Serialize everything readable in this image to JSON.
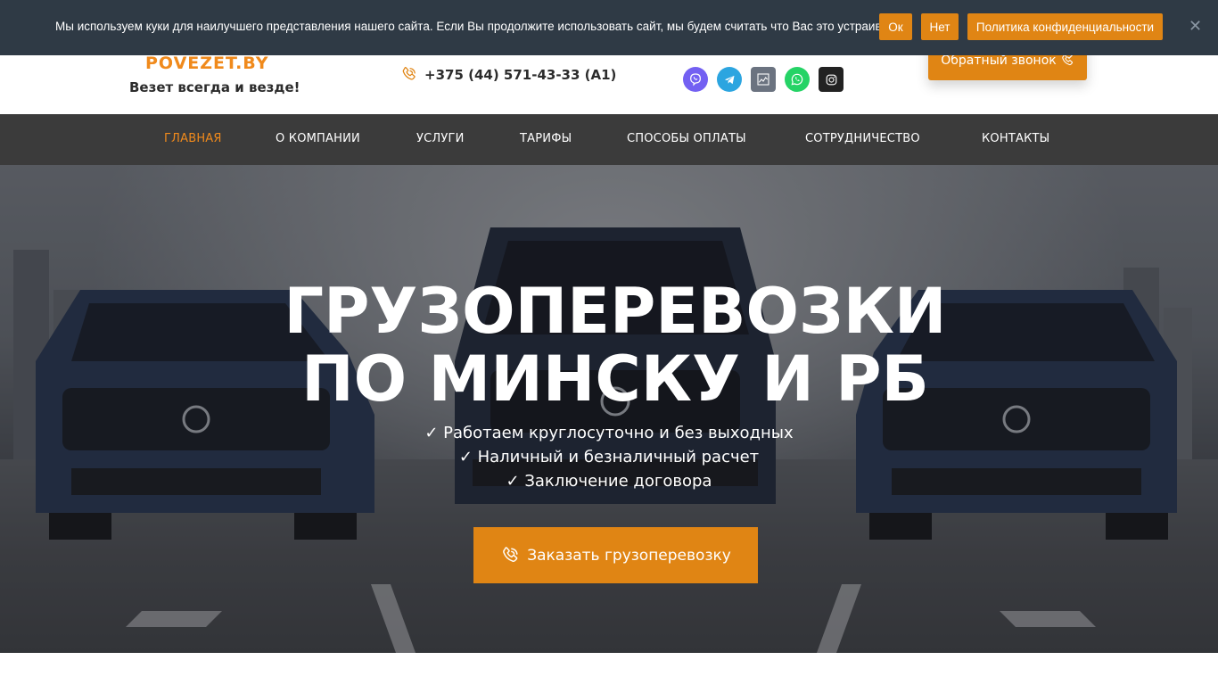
{
  "cookie_bar": {
    "text": "Мы используем куки для наилучшего представления нашего сайта. Если Вы продолжите использовать сайт, мы будем считать что Вас это устраивает.",
    "ok_label": "Ок",
    "no_label": "Нет",
    "policy_label": "Политика конфиденциальности",
    "close_glyph": "✕"
  },
  "header": {
    "logo_text": "POVEZET.BY",
    "tagline": "Везет всегда и везде!",
    "phone": "+375 (44) 571-43-33 (A1)",
    "socials": [
      {
        "name": "viber-icon",
        "color": "#7360f2"
      },
      {
        "name": "telegram-icon",
        "color": "#2ca5e0"
      },
      {
        "name": "chart-icon",
        "color": "#6b7380"
      },
      {
        "name": "whatsapp-icon",
        "color": "#25d366"
      },
      {
        "name": "instagram-icon",
        "color": "#222222"
      }
    ],
    "callback_label": "Обратный звонок"
  },
  "nav": {
    "items": [
      {
        "label": "ГЛАВНАЯ",
        "active": true
      },
      {
        "label": "О КОМПАНИИ",
        "active": false
      },
      {
        "label": "УСЛУГИ",
        "active": false
      },
      {
        "label": "ТАРИФЫ",
        "active": false
      },
      {
        "label": "СПОСОБЫ ОПЛАТЫ",
        "active": false
      },
      {
        "label": "СОТРУДНИЧЕСТВО",
        "active": false
      },
      {
        "label": "КОНТАКТЫ",
        "active": false
      }
    ]
  },
  "hero": {
    "title_line1": "ГРУЗОПЕРЕВОЗКИ",
    "title_line2": "ПО МИНСКУ И РБ",
    "bullets": [
      "✓ Работаем круглосуточно и без выходных",
      "✓ Наличный и безналичный расчет",
      "✓ Заключение договора"
    ],
    "order_label": "Заказать грузоперевозку"
  },
  "colors": {
    "accent": "#e08514",
    "cookie_bg": "#2f3a45",
    "nav_bg": "#3b3b3b"
  }
}
